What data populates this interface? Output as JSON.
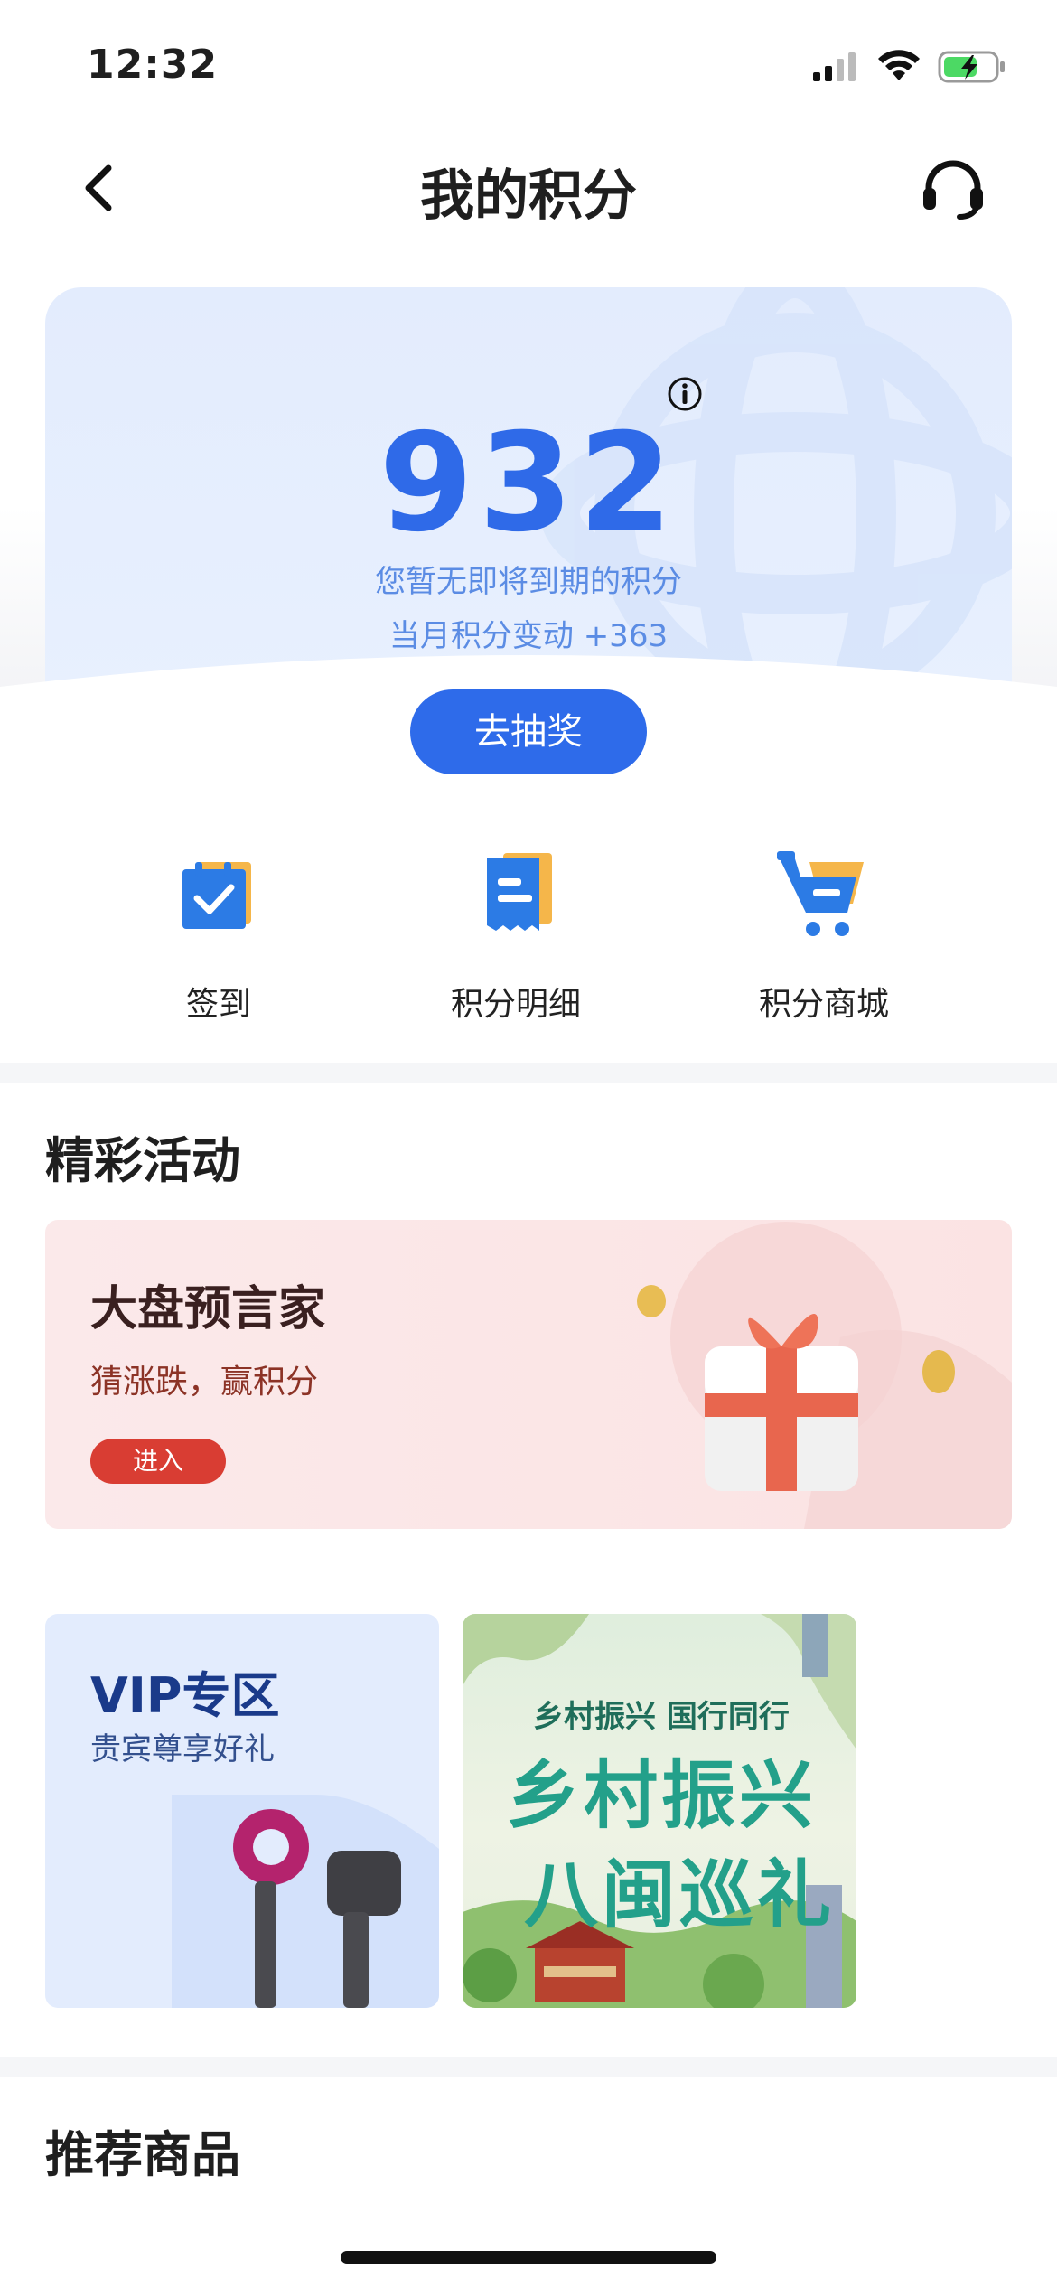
{
  "status_bar": {
    "time": "12:32"
  },
  "nav": {
    "title": "我的积分"
  },
  "points": {
    "value": "932",
    "expire_text": "您暂无即将到期的积分",
    "month_change": "当月积分变动 +363",
    "draw_label": "去抽奖"
  },
  "entries": [
    {
      "label": "签到",
      "icon": "calendar-check-icon"
    },
    {
      "label": "积分明细",
      "icon": "receipt-icon"
    },
    {
      "label": "积分商城",
      "icon": "shopping-cart-icon"
    }
  ],
  "activities": {
    "title": "精彩活动",
    "predict": {
      "title": "大盘预言家",
      "subtitle": "猜涨跌，赢积分",
      "button": "进入"
    },
    "vip": {
      "title": "VIP专区",
      "subtitle": "贵宾尊享好礼"
    },
    "village": {
      "top_text": "乡村振兴 国行同行",
      "line1": "乡村振兴",
      "line2": "八闽巡礼"
    }
  },
  "recommend": {
    "title": "推荐商品"
  },
  "colors": {
    "accent": "#2e6bea",
    "predict_button": "#d93d33"
  }
}
